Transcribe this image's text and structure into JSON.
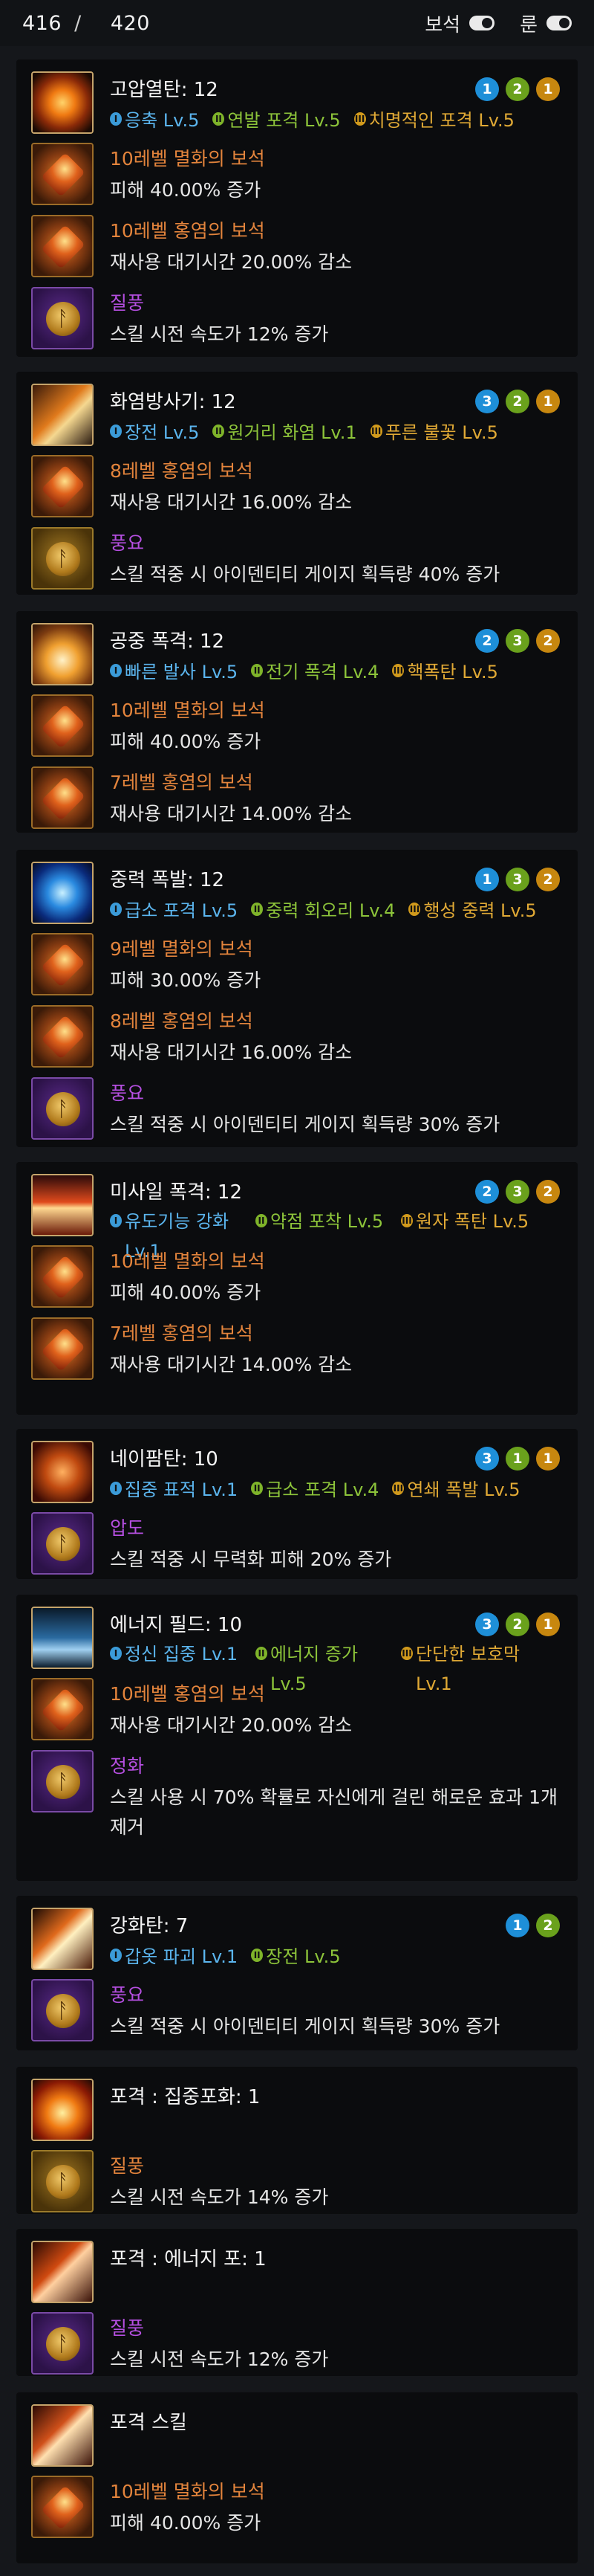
{
  "header": {
    "points_used": "416",
    "points_separator": "/",
    "points_total": "420",
    "gem_toggle_label": "보석",
    "rune_toggle_label": "룬"
  },
  "skills": [
    {
      "name": "고압열탄",
      "level": ": 12",
      "icon": "fire-burst-icon",
      "badges": [
        "1",
        "2",
        "1"
      ],
      "tripods": [
        {
          "tier": "I",
          "name": "응축 Lv.5"
        },
        {
          "tier": "II",
          "name": "연발 포격 Lv.5"
        },
        {
          "tier": "III",
          "name": "치명적인 포격 Lv.5"
        }
      ],
      "effects": [
        {
          "kind": "gem",
          "title": "10레벨 멸화의 보석",
          "desc": "피해 40.00% 증가"
        },
        {
          "kind": "gem",
          "title": "10레벨 홍염의 보석",
          "desc": "재사용 대기시간 20.00% 감소"
        },
        {
          "kind": "rune",
          "title": "질풍",
          "desc": "스킬 시전 속도가 12% 증가"
        }
      ]
    },
    {
      "name": "화염방사기",
      "level": ": 12",
      "icon": "flamethrower-icon",
      "badges": [
        "3",
        "2",
        "1"
      ],
      "tripods": [
        {
          "tier": "I",
          "name": "장전 Lv.5"
        },
        {
          "tier": "II",
          "name": "원거리 화염 Lv.1"
        },
        {
          "tier": "III",
          "name": "푸른 불꽃 Lv.5"
        }
      ],
      "effects": [
        {
          "kind": "gem",
          "title": "8레벨 홍염의 보석",
          "desc": "재사용 대기시간 16.00% 감소"
        },
        {
          "kind": "rune-gold",
          "title": "풍요",
          "desc": "스킬 적중 시 아이덴티티 게이지 획득량 40% 증가"
        }
      ]
    },
    {
      "name": "공중 폭격",
      "level": ": 12",
      "icon": "air-strike-icon",
      "badges": [
        "2",
        "3",
        "2"
      ],
      "tripods": [
        {
          "tier": "I",
          "name": "빠른 발사 Lv.5"
        },
        {
          "tier": "II",
          "name": "전기 폭격 Lv.4"
        },
        {
          "tier": "III",
          "name": "핵폭탄 Lv.5"
        }
      ],
      "effects": [
        {
          "kind": "gem",
          "title": "10레벨 멸화의 보석",
          "desc": "피해 40.00% 증가"
        },
        {
          "kind": "gem",
          "title": "7레벨 홍염의 보석",
          "desc": "재사용 대기시간 14.00% 감소"
        }
      ]
    },
    {
      "name": "중력 폭발",
      "level": ": 12",
      "icon": "gravity-blast-icon",
      "badges": [
        "1",
        "3",
        "2"
      ],
      "tripods": [
        {
          "tier": "I",
          "name": "급소 포격 Lv.5"
        },
        {
          "tier": "II",
          "name": "중력 회오리 Lv.4"
        },
        {
          "tier": "III",
          "name": "행성 중력 Lv.5"
        }
      ],
      "effects": [
        {
          "kind": "gem",
          "title": "9레벨 멸화의 보석",
          "desc": "피해 30.00% 증가"
        },
        {
          "kind": "gem",
          "title": "8레벨 홍염의 보석",
          "desc": "재사용 대기시간 16.00% 감소"
        },
        {
          "kind": "rune",
          "title": "풍요",
          "desc": "스킬 적중 시 아이덴티티 게이지 획득량 30% 증가"
        }
      ]
    },
    {
      "name": "미사일 폭격",
      "level": ": 12",
      "icon": "missile-strike-icon",
      "badges": [
        "2",
        "3",
        "2"
      ],
      "tripods": [
        {
          "tier": "I",
          "name": "유도기능 강화 Lv.1"
        },
        {
          "tier": "II",
          "name": "약점 포착 Lv.5"
        },
        {
          "tier": "III",
          "name": "원자 폭탄 Lv.5"
        }
      ],
      "effects": [
        {
          "kind": "gem",
          "title": "10레벨 멸화의 보석",
          "desc": "피해 40.00% 증가"
        },
        {
          "kind": "gem",
          "title": "7레벨 홍염의 보석",
          "desc": "재사용 대기시간 14.00% 감소"
        }
      ]
    },
    {
      "name": "네이팜탄",
      "level": ": 10",
      "icon": "napalm-icon",
      "badges": [
        "3",
        "1",
        "1"
      ],
      "tripods": [
        {
          "tier": "I",
          "name": "집중 표적 Lv.1"
        },
        {
          "tier": "II",
          "name": "급소 포격 Lv.4"
        },
        {
          "tier": "III",
          "name": "연쇄 폭발 Lv.5"
        }
      ],
      "effects": [
        {
          "kind": "rune",
          "title": "압도",
          "desc": "스킬 적중 시 무력화 피해 20% 증가"
        }
      ]
    },
    {
      "name": "에너지 필드",
      "level": ": 10",
      "icon": "energy-field-icon",
      "badges": [
        "3",
        "2",
        "1"
      ],
      "tripods": [
        {
          "tier": "I",
          "name": "정신 집중 Lv.1"
        },
        {
          "tier": "II",
          "name": "에너지 증가 Lv.5"
        },
        {
          "tier": "III",
          "name": "단단한 보호막 Lv.1"
        }
      ],
      "effects": [
        {
          "kind": "gem",
          "title": "10레벨 홍염의 보석",
          "desc": "재사용 대기시간 20.00% 감소"
        },
        {
          "kind": "rune",
          "title": "정화",
          "desc": "스킬 사용 시 70% 확률로 자신에게 걸린 해로운 효과 1개 제거"
        }
      ]
    },
    {
      "name": "강화탄",
      "level": ": 7",
      "icon": "enhanced-shell-icon",
      "badges": [
        "1",
        "2"
      ],
      "tripods": [
        {
          "tier": "I",
          "name": "갑옷 파괴 Lv.1"
        },
        {
          "tier": "II",
          "name": "장전 Lv.5"
        }
      ],
      "effects": [
        {
          "kind": "rune",
          "title": "풍요",
          "desc": "스킬 적중 시 아이덴티티 게이지 획득량 30% 증가"
        }
      ]
    },
    {
      "name": "포격 : 집중포화",
      "level": ": 1",
      "icon": "focus-barrage-icon",
      "badges": [],
      "tripods": [],
      "effects": [
        {
          "kind": "rune-legend",
          "title": "질풍",
          "desc": "스킬 시전 속도가 14% 증가"
        }
      ]
    },
    {
      "name": "포격 : 에너지 포",
      "level": ": 1",
      "icon": "energy-cannon-icon",
      "badges": [],
      "tripods": [],
      "effects": [
        {
          "kind": "rune",
          "title": "질풍",
          "desc": "스킬 시전 속도가 12% 증가"
        }
      ]
    },
    {
      "name": "포격 스킬",
      "level": "",
      "icon": "barrage-skill-icon",
      "badges": [],
      "tripods": [],
      "effects": [
        {
          "kind": "gem",
          "title": "10레벨 멸화의 보석",
          "desc": "피해 40.00% 증가"
        }
      ]
    }
  ]
}
